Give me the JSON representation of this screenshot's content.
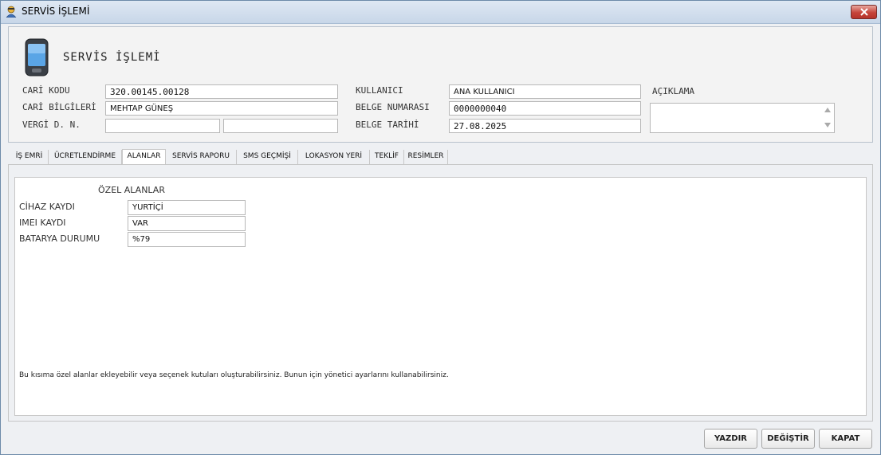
{
  "window": {
    "title": "SERVİS İŞLEMİ"
  },
  "header": {
    "title": "SERVİS İŞLEMİ"
  },
  "form": {
    "cari_kodu": {
      "label": "CARİ KODU",
      "value": "320.00145.00128"
    },
    "cari_bilgileri": {
      "label": "CARİ BİLGİLERİ",
      "value": "MEHTAP GÜNEŞ"
    },
    "vergi": {
      "label": "VERGİ D. N.",
      "value1": "",
      "value2": ""
    },
    "kullanici": {
      "label": "KULLANICI",
      "value": "ANA KULLANICI"
    },
    "belge_numarasi": {
      "label": "BELGE NUMARASI",
      "value": "0000000040"
    },
    "belge_tarihi": {
      "label": "BELGE TARİHİ",
      "value": "27.08.2025"
    },
    "aciklama": {
      "label": "AÇIKLAMA",
      "value": ""
    }
  },
  "tabs": [
    {
      "label": "İŞ EMRİ",
      "active": false
    },
    {
      "label": "ÜCRETLENDİRME",
      "active": false
    },
    {
      "label": "ALANLAR",
      "active": true
    },
    {
      "label": "SERVİS RAPORU",
      "active": false
    },
    {
      "label": "SMS GEÇMİŞİ",
      "active": false
    },
    {
      "label": "LOKASYON YERİ",
      "active": false
    },
    {
      "label": "TEKLİF",
      "active": false
    },
    {
      "label": "RESİMLER",
      "active": false
    }
  ],
  "alanlar": {
    "section_title": "ÖZEL ALANLAR",
    "fields": [
      {
        "label": "CİHAZ KAYDI",
        "value": "YURTİÇİ"
      },
      {
        "label": "IMEI KAYDI",
        "value": "VAR"
      },
      {
        "label": "BATARYA DURUMU",
        "value": "%79"
      }
    ],
    "note": "Bu kısıma özel alanlar ekleyebilir veya seçenek kutuları oluşturabilirsiniz. Bunun için yönetici ayarlarını kullanabilirsiniz."
  },
  "buttons": {
    "print": "YAZDIR",
    "edit": "DEĞİŞTİR",
    "close": "KAPAT"
  },
  "icons": {
    "title": "user-icon",
    "header": "mobile-phone-icon",
    "close": "close-icon"
  },
  "colors": {
    "close_button": "#c6443a",
    "titlebar": "#c7d6e8"
  }
}
